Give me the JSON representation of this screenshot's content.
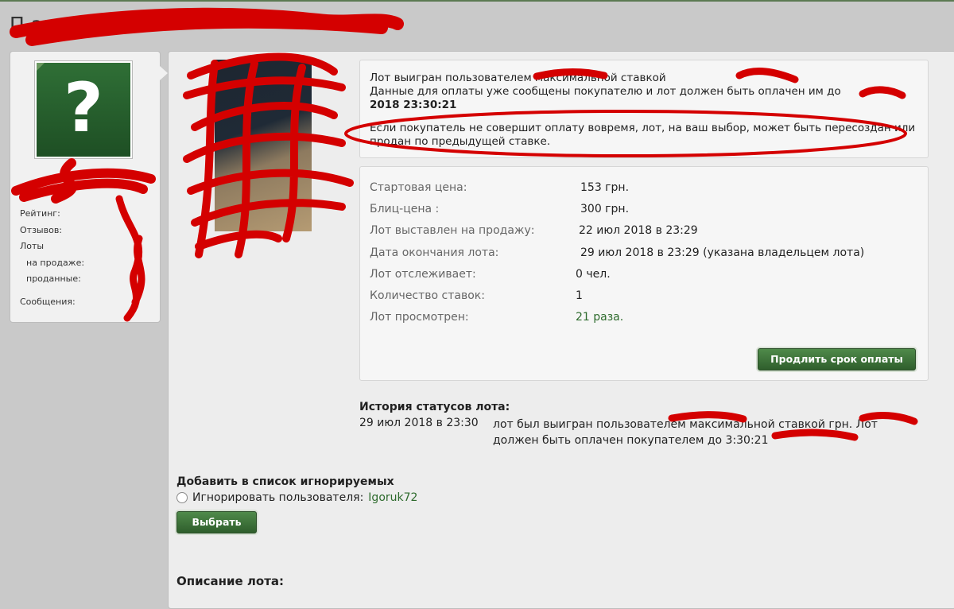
{
  "page": {
    "title_visible": "П                  арак    о          ал."
  },
  "user_card": {
    "avatar_icon": "question-mark-icon",
    "stats": {
      "rating": "Рейтинг:",
      "reviews": "Отзывов:",
      "lots": "Лоты",
      "on_sale": "на продаже:",
      "sold": "проданные:",
      "messages": "Сообщения:"
    }
  },
  "notice": {
    "line1": "Лот выигран пользователем           максимальной ставкой",
    "line2": "Данные для оплаты уже сообщены покупателю и лот должен быть оплачен им до",
    "line3": "2018 23:30:21",
    "line4": "Если покупатель не совершит оплату вовремя, лот, на ваш выбор, может быть пересоздан или продан по предыдущей ставке."
  },
  "details": [
    {
      "label": "Стартовая цена:",
      "value": "153 грн."
    },
    {
      "label": "Блиц-цена :",
      "value": "300 грн."
    },
    {
      "label": "Лот выставлен на продажу:",
      "value": "22 июл 2018 в 23:29"
    },
    {
      "label": "Дата окончания лота:",
      "value": "29 июл 2018 в 23:29 (указана владельцем лота)"
    },
    {
      "label": "Лот отслеживает:",
      "value": "0 чел."
    },
    {
      "label": "Количество ставок:",
      "value": "1"
    },
    {
      "label": "Лот просмотрен:",
      "value": "21 раза."
    }
  ],
  "buttons": {
    "extend_payment": "Продлить срок оплаты",
    "choose": "Выбрать"
  },
  "history": {
    "title": "История статусов лота:",
    "date": "29 июл 2018 в 23:30",
    "text": "лот был выигран пользователем            максимальной ставкой         грн. Лот должен быть оплачен покупателем до                 3:30:21"
  },
  "ignore": {
    "title": "Добавить в список игнорируемых",
    "label": "Игнорировать пользователя:",
    "user": "Igoruk72"
  },
  "description": {
    "title": "Описание лота:"
  },
  "colors": {
    "accent_green": "#2e6b2d",
    "scribble_red": "#d40000"
  }
}
